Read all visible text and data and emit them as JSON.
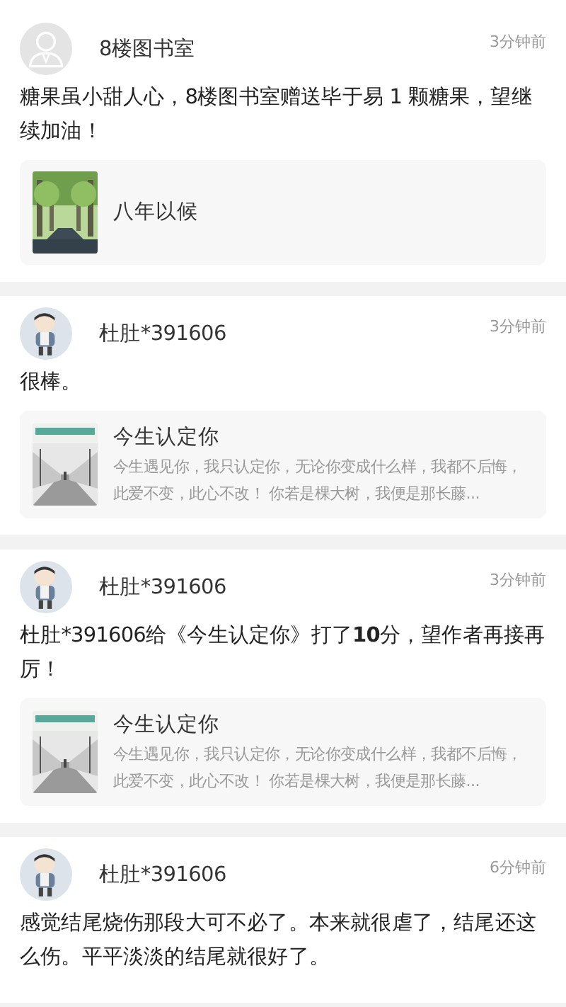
{
  "posts": [
    {
      "user": "8楼图书室",
      "avatar": {
        "kind": "default"
      },
      "time": "3分钟前",
      "text": "糖果虽小甜人心，8楼图书室赠送毕于易 1 颗糖果，望继续加油！",
      "quote": {
        "title": "八年以候",
        "thumb": {
          "kind": "trees"
        }
      }
    },
    {
      "user": "杜肚*391606",
      "avatar": {
        "kind": "figure"
      },
      "time": "3分钟前",
      "text": "很棒。",
      "quote": {
        "title": "今生认定你",
        "desc": "今生遇见你，我只认定你，无论你变成什么样，我都不后悔，此爱不变，此心不改！ 你若是棵大树，我便是那长藤...",
        "thumb": {
          "kind": "corridor"
        }
      }
    },
    {
      "user": "杜肚*391606",
      "avatar": {
        "kind": "figure"
      },
      "time": "3分钟前",
      "text": "杜肚*391606给《今生认定你》打了**10**分，望作者再接再厉！",
      "quote": {
        "title": "今生认定你",
        "desc": "今生遇见你，我只认定你，无论你变成什么样，我都不后悔，此爱不变，此心不改！ 你若是棵大树，我便是那长藤...",
        "thumb": {
          "kind": "corridor"
        }
      }
    },
    {
      "user": "杜肚*391606",
      "avatar": {
        "kind": "figure"
      },
      "time": "6分钟前",
      "text": "感觉结尾烧伤那段大可不必了。本来就很虐了，结尾还这么伤。平平淡淡的结尾就很好了。"
    }
  ]
}
